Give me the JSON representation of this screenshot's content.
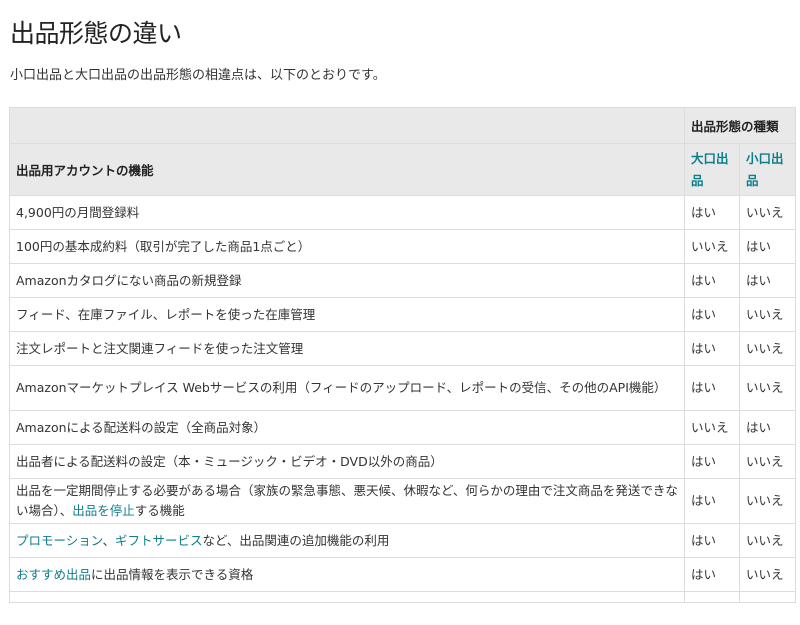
{
  "page": {
    "title": "出品形態の違い",
    "intro": "小口出品と大口出品の出品形態の相違点は、以下のとおりです。"
  },
  "table": {
    "group_header": "出品形態の種類",
    "feature_header": "出品用アカウントの機能",
    "col_a_header": "大口出品",
    "col_b_header": "小口出品",
    "rows": [
      {
        "feature": "4,900円の月間登録料",
        "a": "はい",
        "b": "いいえ"
      },
      {
        "feature": "100円の基本成約料（取引が完了した商品1点ごと）",
        "a": "いいえ",
        "b": "はい"
      },
      {
        "feature": "Amazonカタログにない商品の新規登録",
        "a": "はい",
        "b": "はい"
      },
      {
        "feature": "フィード、在庫ファイル、レポートを使った在庫管理",
        "a": "はい",
        "b": "いいえ"
      },
      {
        "feature": "注文レポートと注文関連フィードを使った注文管理",
        "a": "はい",
        "b": "いいえ"
      },
      {
        "feature": "Amazonマーケットプレイス Webサービスの利用（フィードのアップロード、レポートの受信、その他のAPI機能）",
        "a": "はい",
        "b": "いいえ"
      },
      {
        "feature": "Amazonによる配送料の設定（全商品対象）",
        "a": "いいえ",
        "b": "はい"
      },
      {
        "feature": "出品者による配送料の設定（本・ミュージック・ビデオ・DVD以外の商品）",
        "a": "はい",
        "b": "いいえ"
      },
      {
        "feature_pre": "出品を一定期間停止する必要がある場合（家族の緊急事態、悪天候、休暇など、何らかの理由で注文商品を発送できない場合）、",
        "feature_link": "出品を停止",
        "feature_post": "する機能",
        "a": "はい",
        "b": "いいえ"
      },
      {
        "feature_link": "プロモーション",
        "feature_sep": "、",
        "feature_link2": "ギフトサービス",
        "feature_post": "など、出品関連の追加機能の利用",
        "a": "はい",
        "b": "いいえ"
      },
      {
        "feature_link": "おすすめ出品",
        "feature_post": "に出品情報を表示できる資格",
        "a": "はい",
        "b": "いいえ"
      }
    ]
  }
}
